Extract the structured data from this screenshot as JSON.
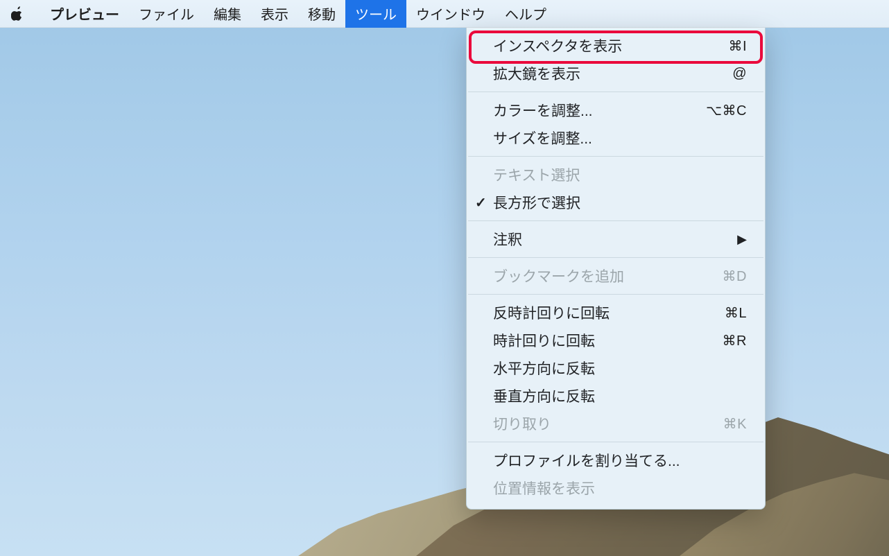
{
  "menubar": {
    "app_name": "プレビュー",
    "items": [
      {
        "label": "ファイル"
      },
      {
        "label": "編集"
      },
      {
        "label": "表示"
      },
      {
        "label": "移動"
      },
      {
        "label": "ツール",
        "selected": true
      },
      {
        "label": "ウインドウ"
      },
      {
        "label": "ヘルプ"
      }
    ]
  },
  "tools_menu": {
    "items": [
      {
        "label": "インスペクタを表示",
        "shortcut": "⌘I"
      },
      {
        "label": "拡大鏡を表示",
        "shortcut": "@"
      },
      {
        "sep": true
      },
      {
        "label": "カラーを調整...",
        "shortcut": "⌥⌘C"
      },
      {
        "label": "サイズを調整..."
      },
      {
        "sep": true
      },
      {
        "label": "テキスト選択",
        "disabled": true
      },
      {
        "label": "長方形で選択",
        "checked": true
      },
      {
        "sep": true
      },
      {
        "label": "注釈",
        "submenu": true
      },
      {
        "sep": true
      },
      {
        "label": "ブックマークを追加",
        "shortcut": "⌘D",
        "disabled": true
      },
      {
        "sep": true
      },
      {
        "label": "反時計回りに回転",
        "shortcut": "⌘L"
      },
      {
        "label": "時計回りに回転",
        "shortcut": "⌘R"
      },
      {
        "label": "水平方向に反転"
      },
      {
        "label": "垂直方向に反転"
      },
      {
        "label": "切り取り",
        "shortcut": "⌘K",
        "disabled": true
      },
      {
        "sep": true
      },
      {
        "label": "プロファイルを割り当てる..."
      },
      {
        "label": "位置情報を表示",
        "disabled": true
      }
    ]
  },
  "annotation": {
    "highlighted_item_index": 0
  }
}
